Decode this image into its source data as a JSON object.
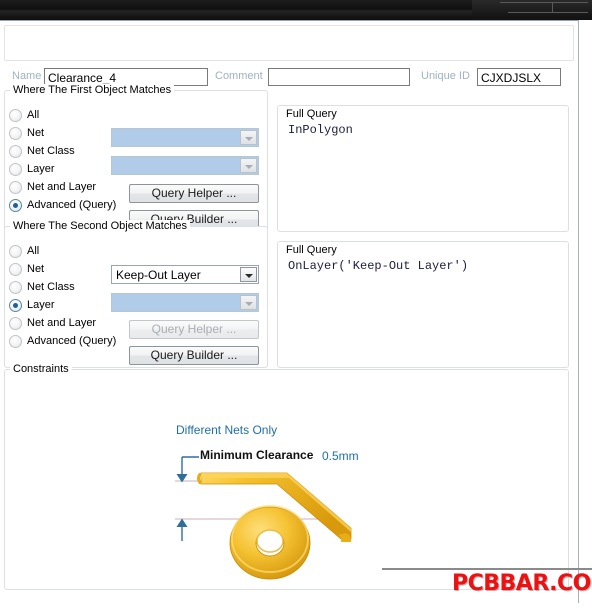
{
  "window": {
    "title_bar": ""
  },
  "header": {
    "name_label": "Name",
    "name_value": "Clearance_4",
    "comment_label": "Comment",
    "comment_value": "",
    "comment_placeholder": "",
    "unique_id_label": "Unique ID",
    "unique_id_value": "CJXDJSLX"
  },
  "first_object": {
    "group_title": "Where The First Object Matches",
    "options": [
      {
        "label": "All",
        "selected": false
      },
      {
        "label": "Net",
        "selected": false
      },
      {
        "label": "Net Class",
        "selected": false
      },
      {
        "label": "Layer",
        "selected": false
      },
      {
        "label": "Net and Layer",
        "selected": false
      },
      {
        "label": "Advanced (Query)",
        "selected": true
      }
    ],
    "combo_net_value": "",
    "combo_netclass_value": "",
    "query_helper_label": "Query Helper ...",
    "query_builder_label": "Query Builder ...",
    "query_helper_enabled": true,
    "query_builder_enabled": true,
    "full_query_title": "Full Query",
    "full_query_text": "InPolygon"
  },
  "second_object": {
    "group_title": "Where The Second Object Matches",
    "options": [
      {
        "label": "All",
        "selected": false
      },
      {
        "label": "Net",
        "selected": false
      },
      {
        "label": "Net Class",
        "selected": false
      },
      {
        "label": "Layer",
        "selected": true
      },
      {
        "label": "Net and Layer",
        "selected": false
      },
      {
        "label": "Advanced (Query)",
        "selected": false
      }
    ],
    "combo_layer_value": "Keep-Out Layer",
    "combo_netclass_value": "",
    "query_helper_label": "Query Helper ...",
    "query_builder_label": "Query Builder ...",
    "query_helper_enabled": false,
    "query_builder_enabled": true,
    "full_query_title": "Full Query",
    "full_query_text": "OnLayer('Keep-Out Layer')"
  },
  "constraints": {
    "group_title": "Constraints",
    "different_nets_label": "Different Nets Only",
    "minimum_clearance_label": "Minimum Clearance",
    "minimum_clearance_value": "0.5mm"
  },
  "watermark": {
    "text": "PCBBAR.COM"
  },
  "colors": {
    "accent_blue": "#1f6fa8",
    "disabled_combo_fill": "#b1cce8",
    "label_blue_grey": "#9fb2c4",
    "trace_gold": "#f0b323",
    "trace_gold_dark": "#d69b10",
    "watermark_red": "#ee1111",
    "guide_line": "#c9b8c4"
  }
}
